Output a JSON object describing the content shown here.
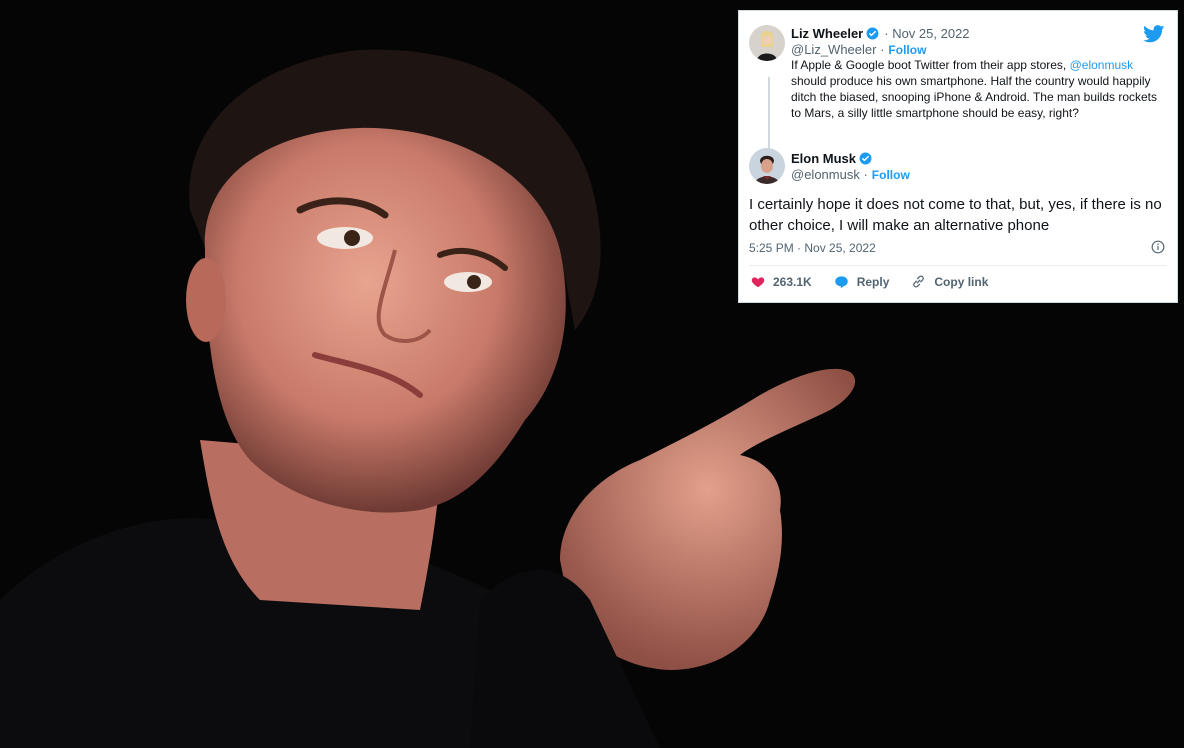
{
  "original_tweet": {
    "author_name": "Liz Wheeler",
    "date": "· Nov 25, 2022",
    "handle": "@Liz_Wheeler ·",
    "follow_label": "Follow",
    "text_part1": "If Apple & Google boot Twitter from their app stores, ",
    "mention": "@elonmusk",
    "text_part2": " should produce his own smartphone. Half the country would happily ditch the biased, snooping iPhone & Android. The man builds rockets to Mars, a silly little smartphone should be easy, right?"
  },
  "reply_tweet": {
    "author_name": "Elon Musk",
    "handle": "@elonmusk ·",
    "follow_label": "Follow",
    "text": "I certainly hope it does not come to that, but, yes, if there is no other choice, I will make an alternative phone",
    "timestamp": "5:25 PM · Nov 25, 2022",
    "like_count": "263.1K",
    "reply_label": "Reply",
    "copy_link_label": "Copy link"
  },
  "icons": [
    "twitter-bird-icon",
    "verified-badge-icon",
    "info-icon",
    "heart-icon",
    "reply-bubble-icon",
    "link-icon"
  ],
  "colors": {
    "brand_blue": "#1d9bf0",
    "heart_red": "#f91880",
    "text": "#0f1419",
    "muted": "#536471",
    "photo_background": "#050505"
  }
}
